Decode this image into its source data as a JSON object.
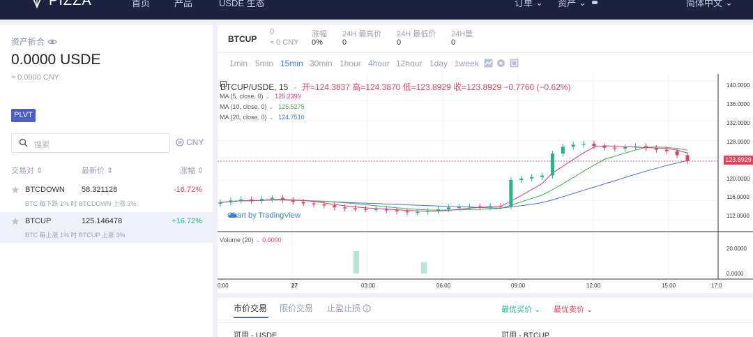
{
  "nav": {
    "brand": "PIZZA",
    "items": [
      "首页",
      "产品",
      "USDE 生态"
    ],
    "right_items": [
      "订单",
      "资产"
    ],
    "language": "简体中文"
  },
  "assets": {
    "label": "资产折合",
    "value": "0.0000 USDE",
    "cny": "≈ 0.0000 CNY"
  },
  "market_tab": "PLVT",
  "search": {
    "placeholder": "搜索",
    "currency": "CNY"
  },
  "table": {
    "headers": [
      "交易对",
      "最新价",
      "涨幅"
    ],
    "rows": [
      {
        "symbol": "BTCDOWN",
        "price": "58.321128",
        "change": "-16.72%",
        "desc": "BTC 每下跌 1% 时 BTCDOWN 上涨 3%",
        "direction": "down"
      },
      {
        "symbol": "BTCUP",
        "price": "125.146478",
        "change": "+16.72%",
        "desc": "BTC 每上涨 1% 时 BTCUP 上涨 3%",
        "direction": "up"
      }
    ]
  },
  "ticker": {
    "symbol": "BTCUP",
    "price": "0",
    "price_cny": "≈ 0 CNY",
    "change_label": "涨幅",
    "change_value": "0%",
    "high_label": "24H 最高价",
    "high_value": "0",
    "low_label": "24H 最低价",
    "low_value": "0",
    "vol_label": "24H量",
    "vol_value": "0"
  },
  "intervals": [
    "1min",
    "5min",
    "15min",
    "30min",
    "1hour",
    "4hour",
    "12hour",
    "1day",
    "1week"
  ],
  "selected_interval": "15min",
  "chart": {
    "pair_title": "BTCUP/USDE, 15",
    "ohlc": "开=124.3837  高=124.3870  低=123.8929  收=123.8929  −0.7760 (−0.62%)",
    "ma": [
      {
        "label": "MA (5, close, 0)",
        "value": "125.2399",
        "color": "#e0348f"
      },
      {
        "label": "MA (10, close, 0)",
        "value": "125.5275",
        "color": "#3fb04a"
      },
      {
        "label": "MA (20, close, 0)",
        "value": "124.7510",
        "color": "#4a6fd6"
      }
    ],
    "brand": "Chart by TradingView",
    "volume_label": "Volume (20)",
    "volume_value": "0.0000",
    "last_price": "123.8929",
    "y_ticks": [
      "140.0000",
      "136.0000",
      "132.0000",
      "128.0000",
      "124.0000",
      "120.0000",
      "116.0000",
      "112.0000"
    ],
    "vol_ticks": [
      "20.0000",
      "0.0000"
    ],
    "x_ticks": [
      "0:00",
      "27",
      "03:00",
      "06:00",
      "09:00",
      "12:00",
      "15:00",
      "17:0"
    ],
    "up_color": "#22b689",
    "down_color": "#e0435a"
  },
  "chart_data": {
    "type": "candlestick",
    "y_range": [
      110,
      141
    ],
    "x_labels": [
      "0:00",
      "27",
      "03:00",
      "06:00",
      "09:00",
      "12:00",
      "15:00",
      "17:0"
    ],
    "close_approx": [
      115.6,
      116.0,
      116.2,
      115.9,
      116.3,
      116.5,
      116.1,
      115.7,
      115.4,
      115.2,
      115.0,
      114.6,
      114.4,
      114.3,
      114.2,
      114.3,
      114.0,
      113.8,
      113.6,
      113.7,
      113.9,
      114.2,
      114.6,
      114.7,
      114.8,
      114.7,
      114.9,
      114.8,
      120.1,
      120.4,
      120.7,
      121.0,
      125.4,
      126.8,
      127.2,
      127.4,
      126.9,
      126.6,
      126.4,
      126.7,
      126.9,
      126.5,
      126.2,
      125.9,
      125.1,
      123.89
    ],
    "volume_peaks": [
      {
        "x": "02:00",
        "v": 20
      },
      {
        "x": "05:00",
        "v": 10
      }
    ]
  }
}
